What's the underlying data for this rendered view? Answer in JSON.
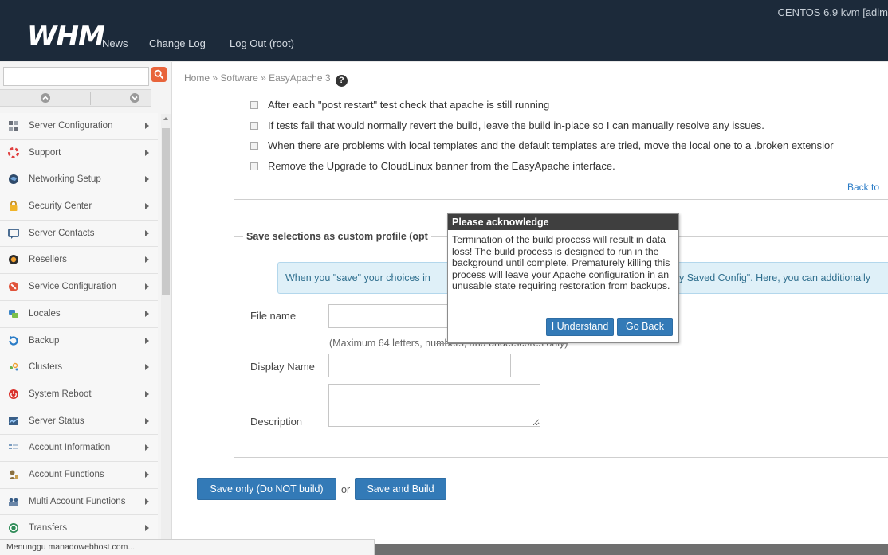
{
  "header": {
    "logo": "WHM",
    "nav": [
      "News",
      "Change Log",
      "Log Out (root)"
    ],
    "host_info": "CENTOS 6.9 kvm [adim"
  },
  "sidebar": {
    "search_placeholder": "",
    "items": [
      {
        "label": "Server Configuration",
        "icon": "server-config-icon"
      },
      {
        "label": "Support",
        "icon": "support-icon"
      },
      {
        "label": "Networking Setup",
        "icon": "networking-icon"
      },
      {
        "label": "Security Center",
        "icon": "lock-icon"
      },
      {
        "label": "Server Contacts",
        "icon": "contacts-icon"
      },
      {
        "label": "Resellers",
        "icon": "resellers-icon"
      },
      {
        "label": "Service Configuration",
        "icon": "service-config-icon"
      },
      {
        "label": "Locales",
        "icon": "locales-icon"
      },
      {
        "label": "Backup",
        "icon": "backup-icon"
      },
      {
        "label": "Clusters",
        "icon": "clusters-icon"
      },
      {
        "label": "System Reboot",
        "icon": "reboot-icon"
      },
      {
        "label": "Server Status",
        "icon": "server-status-icon"
      },
      {
        "label": "Account Information",
        "icon": "account-info-icon"
      },
      {
        "label": "Account Functions",
        "icon": "account-functions-icon"
      },
      {
        "label": "Multi Account Functions",
        "icon": "multi-account-icon"
      },
      {
        "label": "Transfers",
        "icon": "transfers-icon"
      }
    ]
  },
  "breadcrumb": {
    "home": "Home",
    "sep": "»",
    "software": "Software",
    "current": "EasyApache 3"
  },
  "options": [
    "After each \"post restart\" test check that apache is still running",
    "If tests fail that would normally revert the build, leave the build in-place so I can manually resolve any issues.",
    "When there are problems with local templates and the default templates are tried, move the local one to a .broken extensior",
    "Remove the Upgrade to CloudLinux banner from the EasyApache interface."
  ],
  "back_link": "Back to",
  "save_section": {
    "legend": "Save selections as custom profile (opt",
    "info_left": "When you \"save\" your choices in",
    "info_right": "y Saved Config\". Here, you can additionally",
    "file_name_label": "File name",
    "file_name_value": "",
    "file_name_help_prefix": "(Maximum 64 letters, nu",
    "file_name_help_struck": "mbers, and underscores only)",
    "display_name_label": "Display Name",
    "display_name_value": "",
    "description_label": "Description",
    "description_value": ""
  },
  "actions": {
    "save_only": "Save only (Do NOT build)",
    "or": "or",
    "save_build": "Save and Build"
  },
  "modal": {
    "title": "Please acknowledge",
    "body": "Termination of the build process will result in data loss! The build process is designed to run in the background until complete. Prematurely killing this process will leave your Apache configuration in an unusable state requiring restoration from backups.",
    "confirm": "I Understand",
    "cancel": "Go Back"
  },
  "status_bar": "Menunggu manadowebhost.com...",
  "colors": {
    "header_bg": "#1c2a3a",
    "accent": "#337ab7",
    "search_btn": "#e8643b",
    "modal_title_bg": "#3f3f3f",
    "info_bg": "#dff0f8"
  }
}
